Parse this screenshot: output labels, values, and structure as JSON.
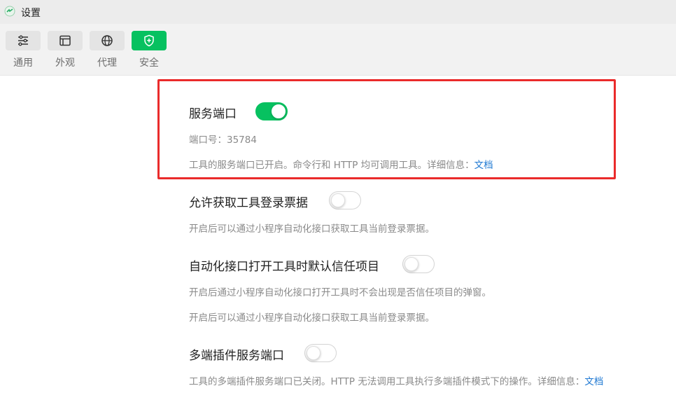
{
  "window": {
    "title": "设置"
  },
  "toolbar": {
    "tabs": [
      {
        "label": "通用",
        "icon": "sliders-icon",
        "active": false
      },
      {
        "label": "外观",
        "icon": "window-icon",
        "active": false
      },
      {
        "label": "代理",
        "icon": "globe-icon",
        "active": false
      },
      {
        "label": "安全",
        "icon": "shield-icon",
        "active": true
      }
    ]
  },
  "settings": {
    "service_port": {
      "title": "服务端口",
      "enabled": true,
      "port_label": "端口号：35784",
      "desc_text": "工具的服务端口已开启。命令行和 HTTP 均可调用工具。详细信息：",
      "link": "文档"
    },
    "login_ticket": {
      "title": "允许获取工具登录票据",
      "enabled": false,
      "desc": "开启后可以通过小程序自动化接口获取工具当前登录票据。"
    },
    "trust_project": {
      "title": "自动化接口打开工具时默认信任项目",
      "enabled": false,
      "desc1": "开启后通过小程序自动化接口打开工具时不会出现是否信任项目的弹窗。",
      "desc2": "开启后可以通过小程序自动化接口获取工具当前登录票据。"
    },
    "multi_port": {
      "title": "多端插件服务端口",
      "enabled": false,
      "desc_text": "工具的多端插件服务端口已关闭。HTTP 无法调用工具执行多端插件模式下的操作。详细信息：",
      "link": "文档"
    }
  },
  "colors": {
    "accent": "#07c160",
    "highlight": "#ea2b2b",
    "link": "#1e78d2"
  }
}
